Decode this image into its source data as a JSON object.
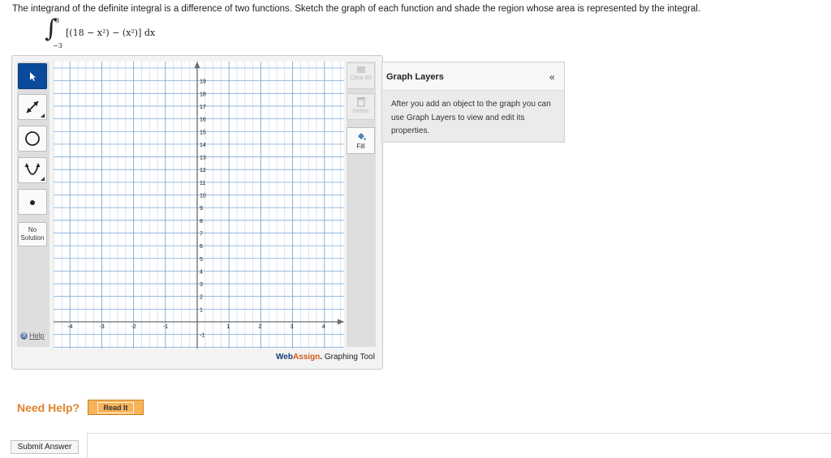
{
  "question": {
    "text": "The integrand of the definite integral is a difference of two functions. Sketch the graph of each function and shade the region whose area is represented by the integral."
  },
  "integral": {
    "upper": "3",
    "lower": "−3",
    "expression": "[(18 − x²) − (x²)] dx"
  },
  "toolbar": {
    "no_solution_label": "No Solution",
    "help_label": "Help",
    "icons": [
      "pointer-icon",
      "line-tool-icon",
      "circle-tool-icon",
      "parabola-tool-icon",
      "point-tool-icon"
    ]
  },
  "right_tools": {
    "clear_all_label": "Clear All",
    "delete_label": "Delete",
    "fill_label": "Fill"
  },
  "graph": {
    "x_ticks": [
      "-4",
      "-3",
      "-2",
      "-1",
      "1",
      "2",
      "3",
      "4"
    ],
    "y_ticks": [
      "19",
      "18",
      "17",
      "16",
      "15",
      "14",
      "13",
      "12",
      "11",
      "10",
      "9",
      "8",
      "7",
      "6",
      "5",
      "4",
      "3",
      "2",
      "1",
      "-1"
    ]
  },
  "brand": {
    "web": "Web",
    "assign": "Assign",
    "dot": ".",
    "tool": " Graphing Tool"
  },
  "layers": {
    "title": "Graph Layers",
    "collapse": "«",
    "body": "After you add an object to the graph you can use Graph Layers to view and edit its properties."
  },
  "help": {
    "need_help": "Need Help?",
    "read_it": "Read It"
  },
  "submit": {
    "label": "Submit Answer"
  }
}
